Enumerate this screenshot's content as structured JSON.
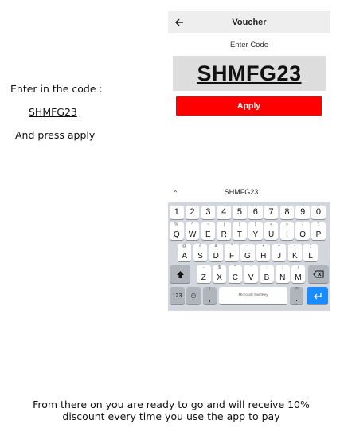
{
  "instructions": {
    "line1": "Enter in the code :",
    "code": "SHMFG23",
    "line2": "And press apply"
  },
  "voucher": {
    "back_icon": "arrow-left-icon",
    "title": "Voucher",
    "enter_code_label": "Enter Code",
    "code_value": "SHMFG23",
    "apply_label": "Apply",
    "apply_color": "#ff0000"
  },
  "keyboard": {
    "suggestion": "SHMFG23",
    "number_row": [
      "1",
      "2",
      "3",
      "4",
      "5",
      "6",
      "7",
      "8",
      "9",
      "0"
    ],
    "row1": [
      {
        "main": "Q",
        "sub": "%"
      },
      {
        "main": "W",
        "sub": "^"
      },
      {
        "main": "E",
        "sub": "~"
      },
      {
        "main": "R",
        "sub": "|"
      },
      {
        "main": "T",
        "sub": "["
      },
      {
        "main": "Y",
        "sub": "]"
      },
      {
        "main": "U",
        "sub": "<"
      },
      {
        "main": "I",
        "sub": ">"
      },
      {
        "main": "O",
        "sub": "{"
      },
      {
        "main": "P",
        "sub": "}"
      }
    ],
    "row2": [
      {
        "main": "A",
        "sub": "@"
      },
      {
        "main": "S",
        "sub": "#"
      },
      {
        "main": "D",
        "sub": "&"
      },
      {
        "main": "F",
        "sub": "*"
      },
      {
        "main": "G",
        "sub": "-"
      },
      {
        "main": "H",
        "sub": "+"
      },
      {
        "main": "J",
        "sub": "="
      },
      {
        "main": "K",
        "sub": "("
      },
      {
        "main": "L",
        "sub": ")"
      }
    ],
    "row3": [
      {
        "main": "Z",
        "sub": "-"
      },
      {
        "main": "X",
        "sub": "$"
      },
      {
        "main": "C",
        "sub": "\""
      },
      {
        "main": "V",
        "sub": "'"
      },
      {
        "main": "B",
        "sub": ":"
      },
      {
        "main": "N",
        "sub": ";"
      },
      {
        "main": "M",
        "sub": "/"
      }
    ],
    "mode_key": "123",
    "emoji_key": "☺",
    "comma_key": ",",
    "comma_sub": "!",
    "space_label": "Microsoft SwiftKey",
    "period_key": ".",
    "period_sub": "?!",
    "enter_color": "#1a8cff"
  },
  "footer": {
    "line1": "From there on you are ready to go and will receive 10%",
    "line2": "discount every time you use the app to pay"
  }
}
